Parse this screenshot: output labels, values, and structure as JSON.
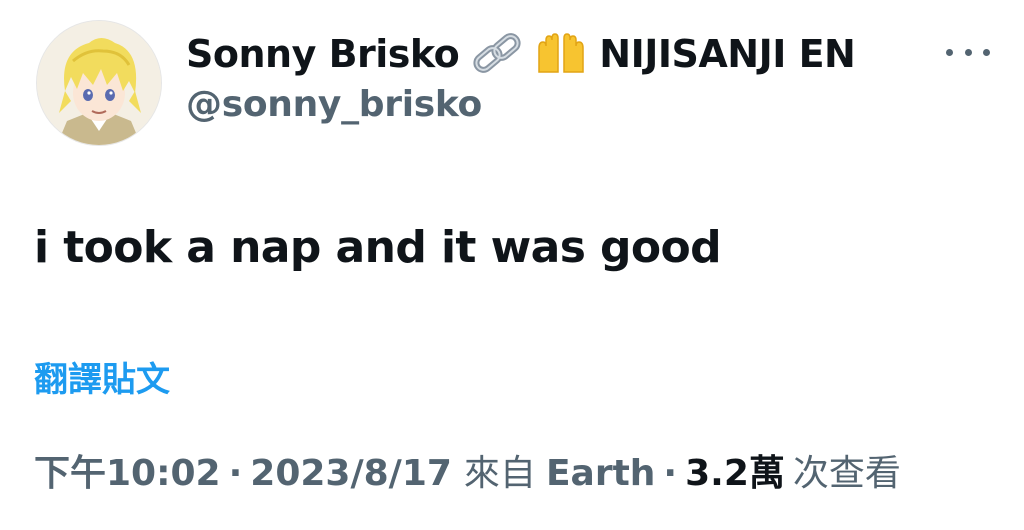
{
  "user": {
    "display_name": "Sonny Brisko",
    "link_emoji": "link-icon",
    "hands_emoji": "raised-hands-icon",
    "affiliation": "NIJISANJI EN",
    "handle": "@sonny_brisko"
  },
  "tweet": {
    "text": "i took a nap and it was good",
    "translate_label": "翻譯貼文"
  },
  "meta": {
    "time": "下午10:02",
    "separator": "·",
    "date": "2023/8/17",
    "source_prefix": "來自",
    "source": "Earth",
    "views_count": "3.2萬",
    "views_label": "次查看"
  },
  "colors": {
    "text": "#0f1419",
    "secondary": "#536471",
    "link": "#1d9bf0"
  }
}
